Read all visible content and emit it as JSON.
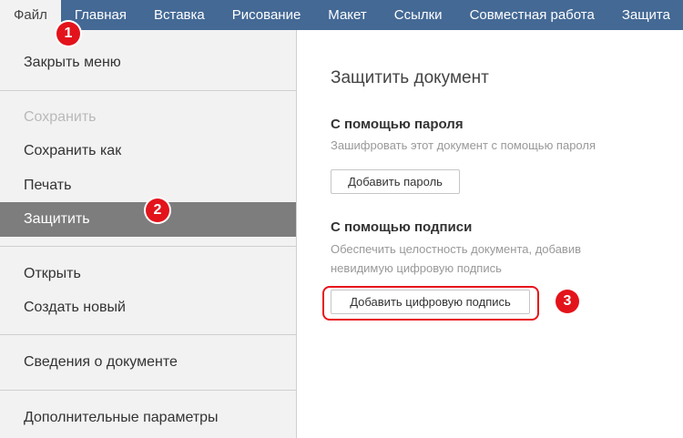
{
  "ribbon": {
    "tabs": [
      {
        "label": "Файл"
      },
      {
        "label": "Главная"
      },
      {
        "label": "Вставка"
      },
      {
        "label": "Рисование"
      },
      {
        "label": "Макет"
      },
      {
        "label": "Ссылки"
      },
      {
        "label": "Совместная работа"
      },
      {
        "label": "Защита"
      }
    ]
  },
  "sidebar": {
    "close_menu": "Закрыть меню",
    "save": "Сохранить",
    "save_as": "Сохранить как",
    "print": "Печать",
    "protect": "Защитить",
    "open": "Открыть",
    "create_new": "Создать новый",
    "doc_info": "Сведения о документе",
    "advanced_settings": "Дополнительные параметры"
  },
  "panel": {
    "title": "Защитить документ",
    "password": {
      "heading": "С помощью пароля",
      "description": "Зашифровать этот документ с помощью пароля",
      "button": "Добавить пароль"
    },
    "signature": {
      "heading": "С помощью подписи",
      "description_line1": "Обеспечить целостность документа, добавив",
      "description_line2": "невидимую цифровую подпись",
      "button": "Добавить цифровую подпись"
    }
  },
  "annotations": {
    "marker1": "1",
    "marker2": "2",
    "marker3": "3",
    "color": "#e3131b"
  }
}
